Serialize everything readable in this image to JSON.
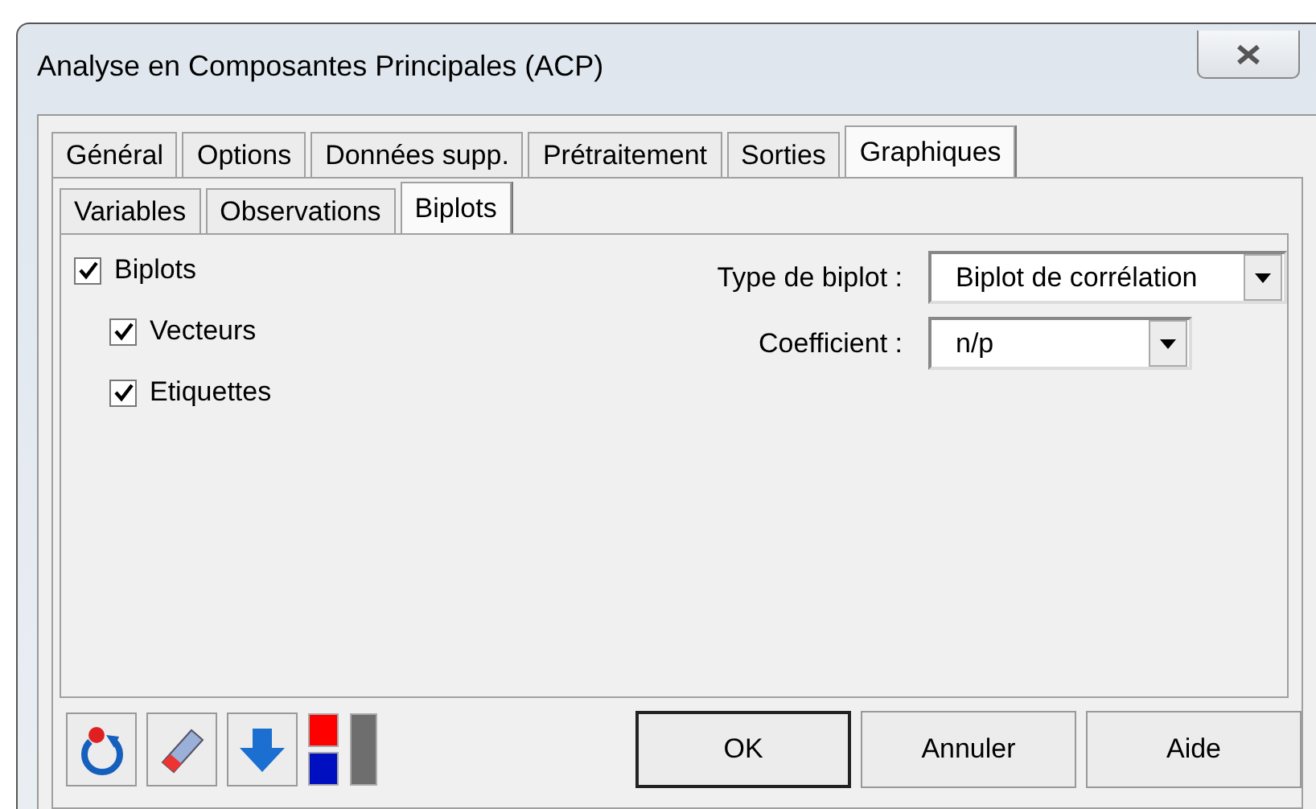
{
  "window": {
    "title": "Analyse en Composantes Principales (ACP)"
  },
  "tabs": [
    {
      "label": "Général",
      "selected": false
    },
    {
      "label": "Options",
      "selected": false
    },
    {
      "label": "Données supp.",
      "selected": false
    },
    {
      "label": "Prétraitement",
      "selected": false
    },
    {
      "label": "Sorties",
      "selected": false
    },
    {
      "label": "Graphiques",
      "selected": true
    }
  ],
  "subtabs": [
    {
      "label": "Variables",
      "selected": false
    },
    {
      "label": "Observations",
      "selected": false
    },
    {
      "label": "Biplots",
      "selected": true
    }
  ],
  "options": [
    {
      "label": "Biplots",
      "checked": true,
      "children": [
        {
          "label": "Vecteurs",
          "checked": true
        },
        {
          "label": "Etiquettes",
          "checked": true
        }
      ]
    }
  ],
  "selects": [
    {
      "label": "Type de biplot :",
      "value": "Biplot de corrélation",
      "wide": true
    },
    {
      "label": "Coefficient :",
      "value": "n/p",
      "wide": false
    }
  ],
  "tools": [
    {
      "kind": "reset"
    },
    {
      "kind": "eraser"
    },
    {
      "kind": "down"
    },
    {
      "kind": "colors"
    }
  ],
  "buttons": [
    {
      "label": "OK",
      "default": true
    },
    {
      "label": "Annuler",
      "default": false
    },
    {
      "label": "Aide",
      "default": false
    }
  ]
}
